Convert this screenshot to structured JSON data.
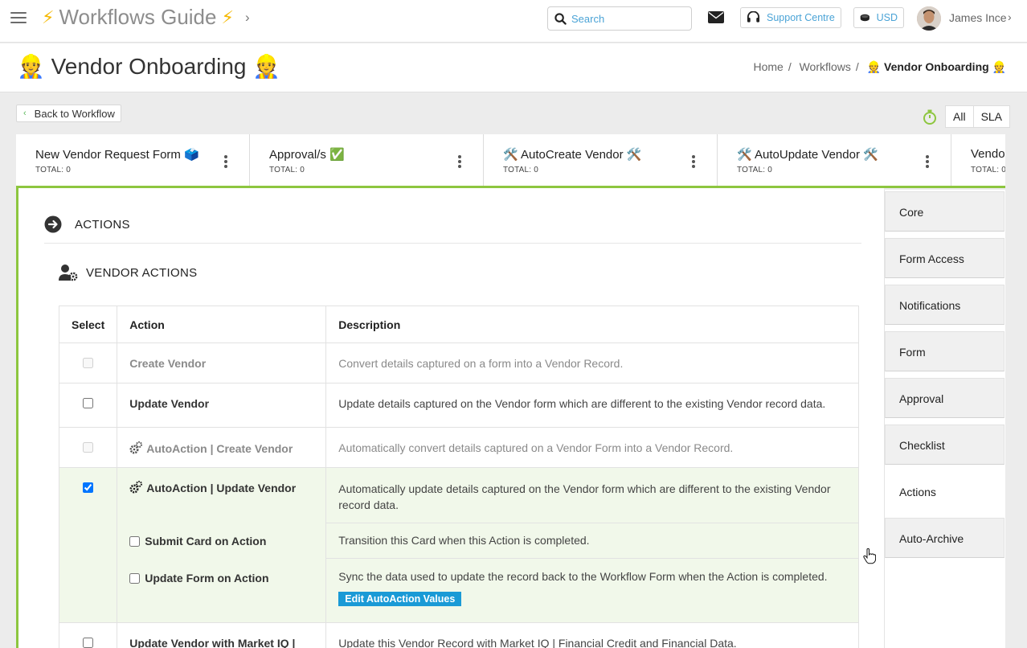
{
  "topbar": {
    "title": "Workflows Guide",
    "search_placeholder": "Search",
    "support_label": "Support Centre",
    "currency_label": "USD",
    "user_name": "James Ince"
  },
  "header": {
    "title": "👷 Vendor Onboarding 👷",
    "breadcrumb": [
      "Home",
      "Workflows",
      "👷 Vendor Onboarding 👷"
    ]
  },
  "toolbar": {
    "back_label": "Back to Workflow",
    "filter_all": "All",
    "filter_sla": "SLA"
  },
  "stages": [
    {
      "name": "New Vendor Request Form 🗳️",
      "total": "TOTAL: 0"
    },
    {
      "name": "Approval/s ✅",
      "total": "TOTAL: 0"
    },
    {
      "name": "🛠️ AutoCreate Vendor 🛠️",
      "total": "TOTAL: 0"
    },
    {
      "name": "🛠️ AutoUpdate Vendor 🛠️",
      "total": "TOTAL: 0"
    },
    {
      "name": "Vendor",
      "total": "TOTAL: 0"
    }
  ],
  "actions": {
    "section_title": "ACTIONS",
    "sub_title": "VENDOR ACTIONS",
    "columns": [
      "Select",
      "Action",
      "Description"
    ],
    "rows": [
      {
        "action": "Create Vendor",
        "description": "Convert details captured on a form into a Vendor Record."
      },
      {
        "action": "Update Vendor",
        "description": "Update details captured on the Vendor form which are different to the existing Vendor record data."
      },
      {
        "action": "AutoAction | Create Vendor",
        "description": "Automatically convert details captured on a Vendor Form into a Vendor Record."
      },
      {
        "action": "AutoAction | Update Vendor",
        "description": "Automatically update details captured on the Vendor form which are different to the existing Vendor record data."
      },
      {
        "action": "Update Vendor with Market IQ |",
        "description": "Update this Vendor Record with Market IQ | Financial Credit and Financial Data."
      }
    ],
    "sub_options": [
      {
        "label": "Submit Card on Action",
        "description": "Transition this Card when this Action is completed."
      },
      {
        "label": "Update Form on Action",
        "description": "Sync the data used to update the record back to the Workflow Form when the Action is completed."
      }
    ],
    "edit_button": "Edit AutoAction Values"
  },
  "sidenav": [
    "Core",
    "Form Access",
    "Notifications",
    "Form",
    "Approval",
    "Checklist",
    "Actions",
    "Auto-Archive"
  ],
  "sidenav_active": "Actions",
  "colors": {
    "accent_green": "#8dc63f",
    "link_blue": "#4aa3d6",
    "button_blue": "#1a9ad6",
    "selected_row": "#f1f8ea"
  }
}
